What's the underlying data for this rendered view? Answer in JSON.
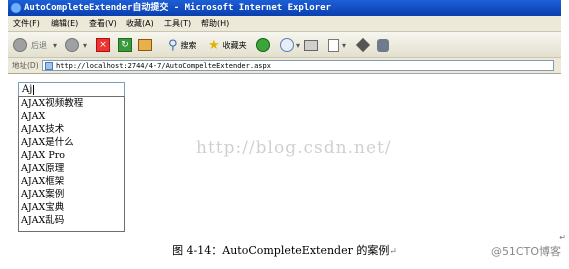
{
  "window": {
    "title": "AutoCompleteExtender自动提交 - Microsoft Internet Explorer"
  },
  "menu": [
    "文件(F)",
    "编辑(E)",
    "查看(V)",
    "收藏(A)",
    "工具(T)",
    "帮助(H)"
  ],
  "toolbar": {
    "back_label": "后退",
    "search_label": "搜索",
    "favorites_label": "收藏夹"
  },
  "address": {
    "label": "地址(D)",
    "url": "http://localhost:2744/4-7/AutoCompelteExtender.aspx"
  },
  "search": {
    "value": "Aj"
  },
  "suggestions": [
    "AJAX视频教程",
    "AJAX",
    "AJAX技术",
    "AJAX是什么",
    "AJAX Pro",
    "AJAX原理",
    "AJAX框架",
    "AJAX案例",
    "AJAX宝典",
    "AJAX乱码"
  ],
  "watermark": "http://blog.csdn.net/",
  "caption": {
    "text": "图 4-14：AutoCompleteExtender 的案例",
    "return_mark": "↵"
  },
  "corner_mark": "@51CTO博客",
  "edge_mark": "↵"
}
